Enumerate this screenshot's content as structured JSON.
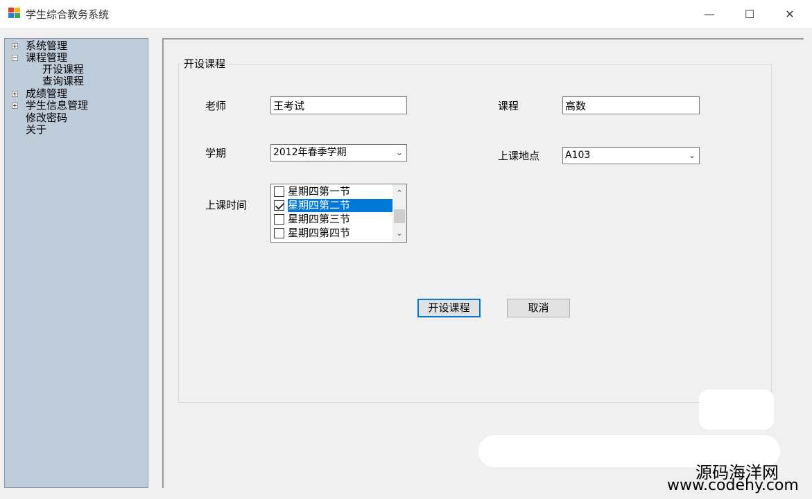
{
  "window": {
    "title": "学生综合教务系统",
    "minimize": "—",
    "maximize": "☐",
    "close": "✕"
  },
  "tree": {
    "items": [
      {
        "label": "系统管理",
        "expander": "plus"
      },
      {
        "label": "课程管理",
        "expander": "minus"
      },
      {
        "label": "开设课程",
        "expander": "none"
      },
      {
        "label": "查询课程",
        "expander": "none"
      },
      {
        "label": "成绩管理",
        "expander": "plus"
      },
      {
        "label": "学生信息管理",
        "expander": "plus"
      },
      {
        "label": "修改密码",
        "expander": "none"
      },
      {
        "label": "关于",
        "expander": "none"
      }
    ]
  },
  "form": {
    "group_title": "开设课程",
    "teacher_label": "老师",
    "teacher_value": "王考试",
    "course_label": "课程",
    "course_value": "高数",
    "semester_label": "学期",
    "semester_value": "2012年春季学期",
    "location_label": "上课地点",
    "location_value": "A103",
    "time_label": "上课时间",
    "time_options": [
      {
        "label": "星期四第一节",
        "checked": false,
        "selected": false
      },
      {
        "label": "星期四第二节",
        "checked": true,
        "selected": true
      },
      {
        "label": "星期四第三节",
        "checked": false,
        "selected": false
      },
      {
        "label": "星期四第四节",
        "checked": false,
        "selected": false
      }
    ],
    "submit_label": "开设课程",
    "cancel_label": "取消"
  },
  "watermark": {
    "line1": "源码海洋网",
    "line2": "www.codehy.com"
  },
  "colors": {
    "selection": "#0078d7",
    "tree_bg": "#bfcddb"
  }
}
